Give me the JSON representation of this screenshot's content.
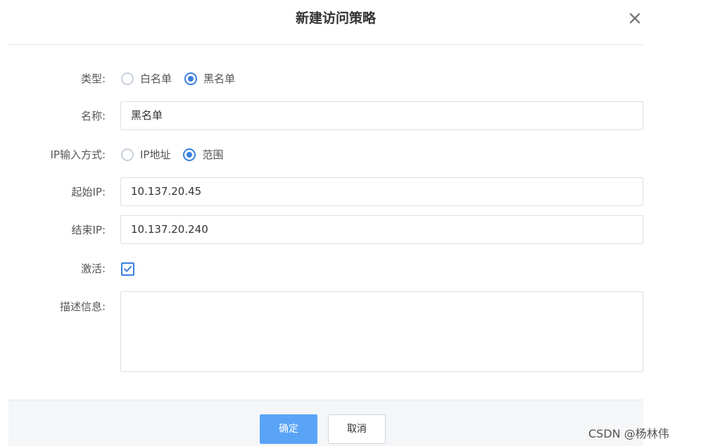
{
  "dialog": {
    "title": "新建访问策略",
    "close_icon": "close-icon"
  },
  "form": {
    "type": {
      "label": "类型:",
      "options": [
        {
          "label": "白名单",
          "checked": false
        },
        {
          "label": "黑名单",
          "checked": true
        }
      ]
    },
    "name": {
      "label": "名称:",
      "value": "黑名单"
    },
    "ip_mode": {
      "label": "IP输入方式:",
      "options": [
        {
          "label": "IP地址",
          "checked": false
        },
        {
          "label": "范围",
          "checked": true
        }
      ]
    },
    "start_ip": {
      "label": "起始IP:",
      "value": "10.137.20.45"
    },
    "end_ip": {
      "label": "结束IP:",
      "value": "10.137.20.240"
    },
    "active": {
      "label": "激活:",
      "checked": true
    },
    "description": {
      "label": "描述信息:",
      "value": ""
    }
  },
  "footer": {
    "ok_label": "确定",
    "cancel_label": "取消"
  },
  "watermark": "CSDN @杨林伟",
  "colors": {
    "accent": "#3a7fe0",
    "primary_button": "#5aa4f7",
    "border": "#dcdfe6",
    "footer_bg": "#f5f6f8"
  }
}
